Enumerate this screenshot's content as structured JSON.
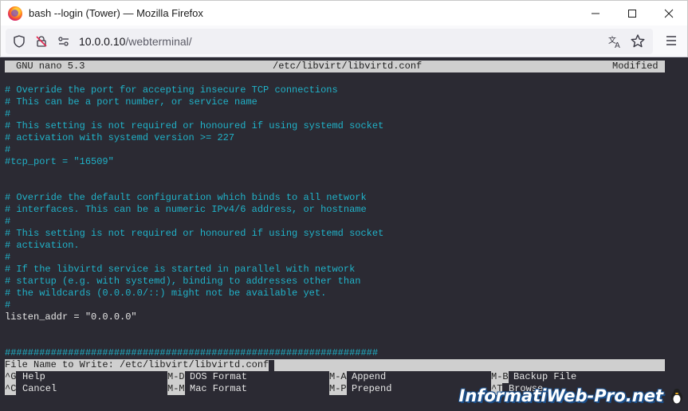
{
  "window": {
    "title": "bash --login (Tower) — Mozilla Firefox",
    "controls": [
      "minimize-icon",
      "maximize-icon",
      "close-icon"
    ]
  },
  "navbar": {
    "url_host": "10.0.0.10",
    "url_path": "/webterminal/",
    "icons": [
      "shield-icon",
      "permissions-icon",
      "site-info-icon",
      "translate-icon",
      "bookmark-star-icon",
      "menu-icon"
    ]
  },
  "nano": {
    "version": "GNU nano 5.3",
    "filename": "/etc/libvirt/libvirtd.conf",
    "status": "Modified",
    "lines": [
      "# Override the port for accepting insecure TCP connections",
      "# This can be a port number, or service name",
      "#",
      "# This setting is not required or honoured if using systemd socket",
      "# activation with systemd version >= 227",
      "#",
      "#tcp_port = \"16509\"",
      "",
      "",
      "# Override the default configuration which binds to all network",
      "# interfaces. This can be a numeric IPv4/6 address, or hostname",
      "#",
      "# This setting is not required or honoured if using systemd socket",
      "# activation.",
      "#",
      "# If the libvirtd service is started in parallel with network",
      "# startup (e.g. with systemd), binding to addresses other than",
      "# the wildcards (0.0.0.0/::) might not be available yet.",
      "#",
      "listen_addr = \"0.0.0.0\"",
      "",
      "",
      "#################################################################"
    ],
    "prompt": "File Name to Write: /etc/libvirt/libvirtd.conf",
    "shortcuts": [
      {
        "key": "^G",
        "label": "Help"
      },
      {
        "key": "M-D",
        "label": "DOS Format"
      },
      {
        "key": "M-A",
        "label": "Append"
      },
      {
        "key": "M-B",
        "label": "Backup File"
      },
      {
        "key": "^C",
        "label": "Cancel"
      },
      {
        "key": "M-M",
        "label": "Mac Format"
      },
      {
        "key": "M-P",
        "label": "Prepend"
      },
      {
        "key": "^T",
        "label": "Browse"
      }
    ]
  },
  "watermark": "InformatiWeb-Pro.net",
  "colors": {
    "terminal_bg": "#2b2a33",
    "comment": "#20b2c8",
    "text": "#e6e6e6",
    "bar": "#cfcfcf"
  }
}
